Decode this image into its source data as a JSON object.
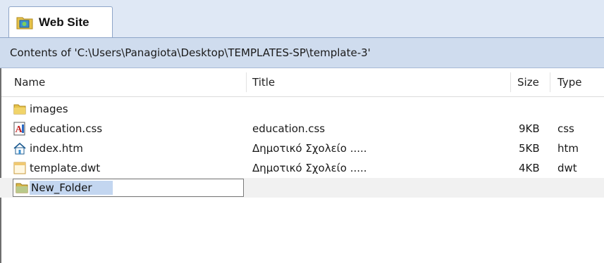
{
  "tab": {
    "label": "Web Site",
    "icon": "web-site-folder-icon"
  },
  "path_bar": {
    "text": "Contents of 'C:\\Users\\Panagiota\\Desktop\\TEMPLATES-SP\\template-3'"
  },
  "columns": {
    "name": "Name",
    "title": "Title",
    "size": "Size",
    "type": "Type"
  },
  "files": [
    {
      "icon": "folder-icon",
      "name": "images",
      "title": "",
      "size": "",
      "type": ""
    },
    {
      "icon": "css-file-icon",
      "name": "education.css",
      "title": "education.css",
      "size": "9KB",
      "type": "css"
    },
    {
      "icon": "home-page-icon",
      "name": "index.htm",
      "title": "Δημοτικό Σχολείο .....",
      "size": "5KB",
      "type": "htm"
    },
    {
      "icon": "template-file-icon",
      "name": "template.dwt",
      "title": "Δημοτικό Σχολείο .....",
      "size": "4KB",
      "type": "dwt"
    }
  ],
  "rename": {
    "icon": "folder-icon",
    "value": "New_Folder"
  },
  "colors": {
    "tab_bar": "#dfe8f5",
    "path_bar": "#cfdcee",
    "selection": "#c3d6f0",
    "folder": "#e6c24a"
  }
}
